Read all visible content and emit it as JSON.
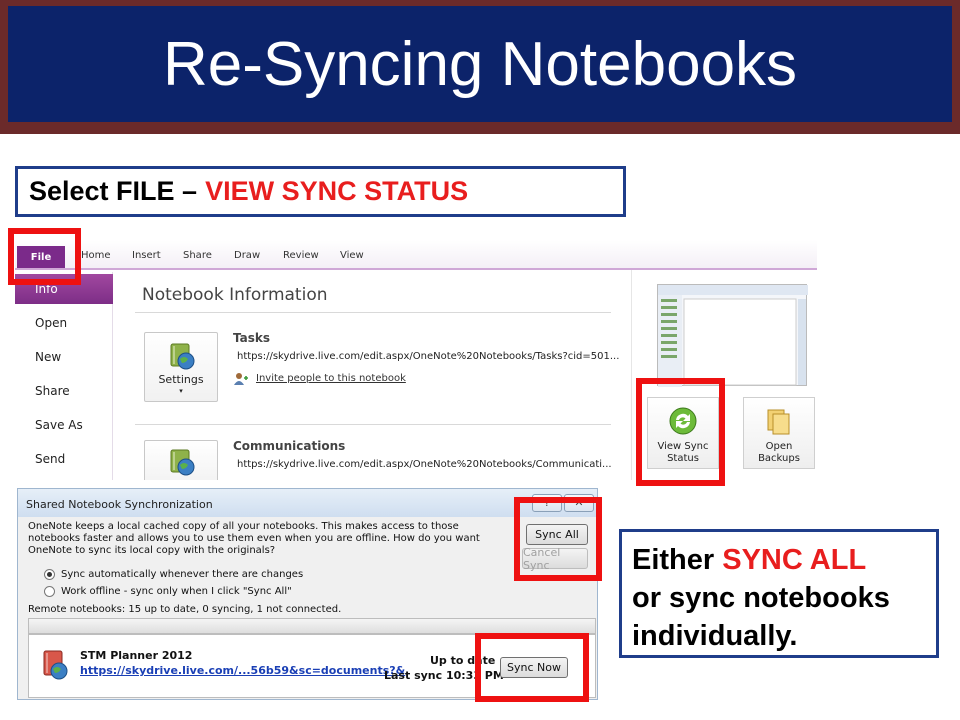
{
  "slide": {
    "title": "Re-Syncing Notebooks"
  },
  "callout_top": {
    "text_black": "Select FILE –",
    "text_red": "VIEW SYNC STATUS"
  },
  "callout_right": {
    "line1_black": "Either ",
    "line1_red": "SYNC ALL",
    "line2": "or sync notebooks",
    "line3": "individually."
  },
  "onenote": {
    "tabs": [
      "File",
      "Home",
      "Insert",
      "Share",
      "Draw",
      "Review",
      "View"
    ],
    "nav": [
      "Info",
      "Open",
      "New",
      "Share",
      "Save As",
      "Send"
    ],
    "heading": "Notebook Information",
    "notebooks": [
      {
        "name": "Tasks",
        "url": "https://skydrive.live.com/edit.aspx/OneNote%20Notebooks/Tasks?cid=501..."
      },
      {
        "name": "Communications",
        "url": "https://skydrive.live.com/edit.aspx/OneNote%20Notebooks/Communicati..."
      }
    ],
    "settings_label": "Settings",
    "invite_label": "Invite people to this notebook",
    "view_sync_label": "View Sync Status",
    "view_sync_line1": "View Sync",
    "view_sync_line2": "Status",
    "open_backups_line1": "Open",
    "open_backups_line2": "Backups"
  },
  "dialog": {
    "title": "Shared Notebook Synchronization",
    "help_glyph": "?",
    "close_glyph": "✕",
    "description": "OneNote keeps a local cached copy of all your notebooks. This makes access to those notebooks faster and allows you to use them even when you are offline. How do you want OneNote to sync its local copy with the originals?",
    "option_auto": "Sync automatically whenever there are changes",
    "option_offline": "Work offline - sync only when I click \"Sync All\"",
    "selected_option": "auto",
    "status": "Remote notebooks: 15 up to date, 0 syncing, 1 not connected.",
    "sync_all_label": "Sync All",
    "cancel_sync_label": "Cancel Sync",
    "notebook_name": "STM Planner 2012",
    "notebook_link": "https://skydrive.live.com/...56b59&sc=documents?&",
    "notebook_status": "Up to date",
    "notebook_lastsync": "Last sync 10:33 PM",
    "sync_now_label": "Sync Now"
  },
  "colors": {
    "banner_blue": "#0c236a",
    "banner_border": "#6b2a2a",
    "highlight_red": "#ee1111",
    "callout_red": "#e81e1e",
    "file_purple": "#7b2a8a"
  }
}
